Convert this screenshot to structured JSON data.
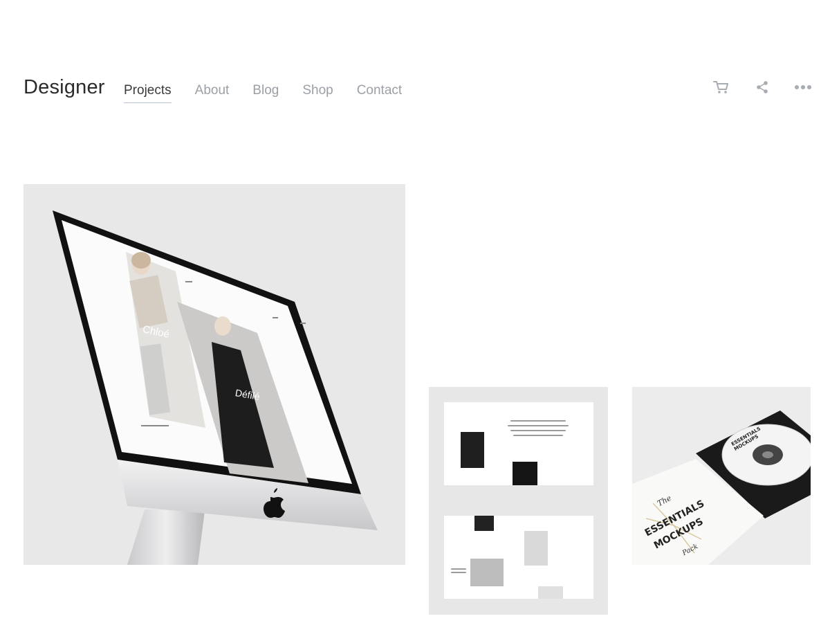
{
  "brand": {
    "logo_text": "Designer"
  },
  "nav": {
    "items": [
      {
        "label": "Projects",
        "active": true
      },
      {
        "label": "About"
      },
      {
        "label": "Blog"
      },
      {
        "label": "Shop"
      },
      {
        "label": "Contact"
      }
    ]
  },
  "header_actions": [
    "cart-icon",
    "share-icon",
    "more-icon"
  ],
  "colors": {
    "nav_text": "#9aa0a6",
    "active_text": "#3a3a3a",
    "active_underline": "#b7c0d0",
    "icon": "#a7acb2"
  },
  "projects": {
    "imac": {
      "screen_word_1": "Chloé",
      "screen_word_2": "Défilé"
    },
    "cd": {
      "line_1": "The",
      "line_2": "ESSENTIALS",
      "line_3": "MOCKUPS",
      "line_4": "Pack"
    }
  }
}
